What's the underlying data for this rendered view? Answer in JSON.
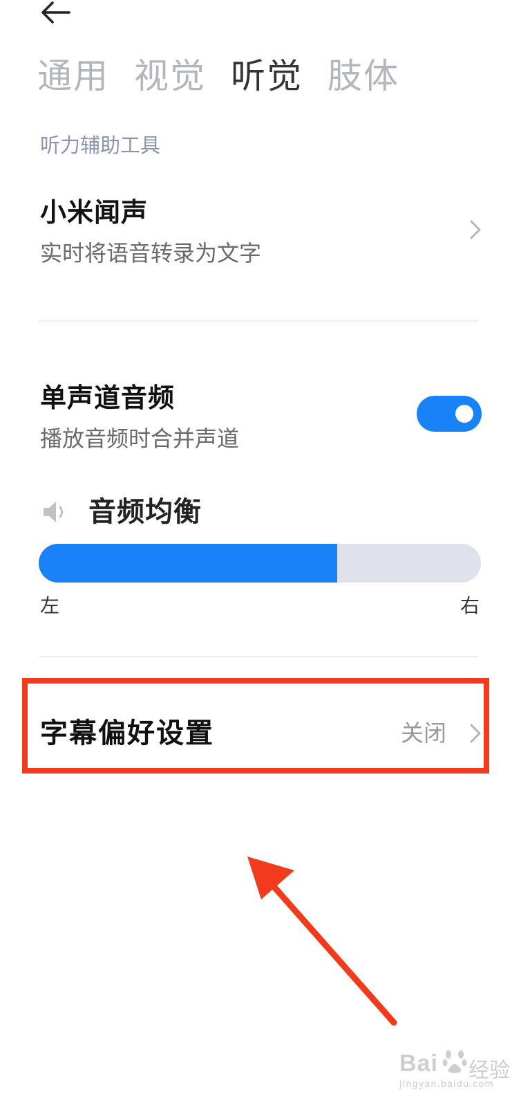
{
  "header": {
    "back_icon": "arrow-left-icon"
  },
  "tabs": [
    {
      "label": "通用",
      "active": false
    },
    {
      "label": "视觉",
      "active": false
    },
    {
      "label": "听觉",
      "active": true
    },
    {
      "label": "肢体",
      "active": false
    }
  ],
  "section": {
    "header": "听力辅助工具"
  },
  "items": {
    "xiaomi_wensheng": {
      "title": "小米闻声",
      "subtitle": "实时将语音转录为文字",
      "icon": "chevron-right-icon"
    },
    "mono_audio": {
      "title": "单声道音频",
      "subtitle": "播放音频时合并声道",
      "toggle_on": true
    },
    "audio_balance": {
      "title": "音频均衡",
      "icon": "speaker-icon",
      "left_label": "左",
      "right_label": "右",
      "value_fraction": 0.675
    },
    "caption_prefs": {
      "title": "字幕偏好设置",
      "value": "关闭",
      "icon": "chevron-right-icon"
    }
  },
  "annotation": {
    "box_color": "#f23b1c",
    "arrow_color": "#f23b1c"
  },
  "watermark": {
    "brand": "Bai",
    "brand_suffix": "经验",
    "url": "jingyan.baidu.com"
  },
  "colors": {
    "accent": "#1a82f7",
    "track": "#dfe2ea",
    "section_header": "#8b93b2"
  }
}
